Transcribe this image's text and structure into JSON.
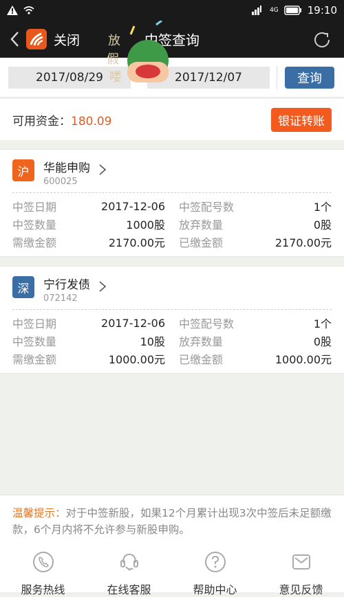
{
  "status_bar": {
    "time": "19:10",
    "network": "4G",
    "icons": [
      "alert-icon",
      "wifi-icon",
      "signal-icon",
      "battery-icon"
    ]
  },
  "navbar": {
    "back_icon": "chevron-left-icon",
    "close_label": "关闭",
    "title": "中签查询",
    "refresh_icon": "refresh-icon"
  },
  "search": {
    "start_date": "2017/08/29",
    "separator": "-",
    "end_date": "2017/12/07",
    "query_label": "查询"
  },
  "funds": {
    "label": "可用资金：",
    "value": "180.09",
    "transfer_label": "银证转账"
  },
  "colors": {
    "accent_orange": "#f25a1e",
    "accent_blue": "#3b6ea5",
    "sh_badge": "#f0651e",
    "sz_badge": "#3b6ea5",
    "funds_value": "#d9602a",
    "tip_label": "#e07a2a"
  },
  "records": [
    {
      "market": "沪",
      "name": "华能申购",
      "code": "600025",
      "fields": {
        "win_date_label": "中签日期",
        "win_date": "2017-12-06",
        "alloc_count_label": "中签配号数",
        "alloc_count": "1个",
        "win_qty_label": "中签数量",
        "win_qty": "1000股",
        "abandon_qty_label": "放弃数量",
        "abandon_qty": "0股",
        "due_label": "需缴金额",
        "due": "2170.00元",
        "paid_label": "已缴金额",
        "paid": "2170.00元"
      }
    },
    {
      "market": "深",
      "name": "宁行发债",
      "code": "072142",
      "fields": {
        "win_date_label": "中签日期",
        "win_date": "2017-12-06",
        "alloc_count_label": "中签配号数",
        "alloc_count": "1个",
        "win_qty_label": "中签数量",
        "win_qty": "10股",
        "abandon_qty_label": "放弃数量",
        "abandon_qty": "0股",
        "due_label": "需缴金额",
        "due": "1000.00元",
        "paid_label": "已缴金额",
        "paid": "1000.00元"
      }
    }
  ],
  "tip": {
    "label": "温馨提示：",
    "text": "对于中签新股，如果12个月累计出现3次中签后未足额缴款，6个月内将不允许参与新股申购。"
  },
  "bottom_nav": [
    {
      "label": "服务热线",
      "icon": "phone-icon"
    },
    {
      "label": "在线客服",
      "icon": "headset-icon"
    },
    {
      "label": "帮助中心",
      "icon": "help-icon"
    },
    {
      "label": "意见反馈",
      "icon": "mail-icon"
    }
  ],
  "sticker": {
    "text": "放假喽"
  }
}
